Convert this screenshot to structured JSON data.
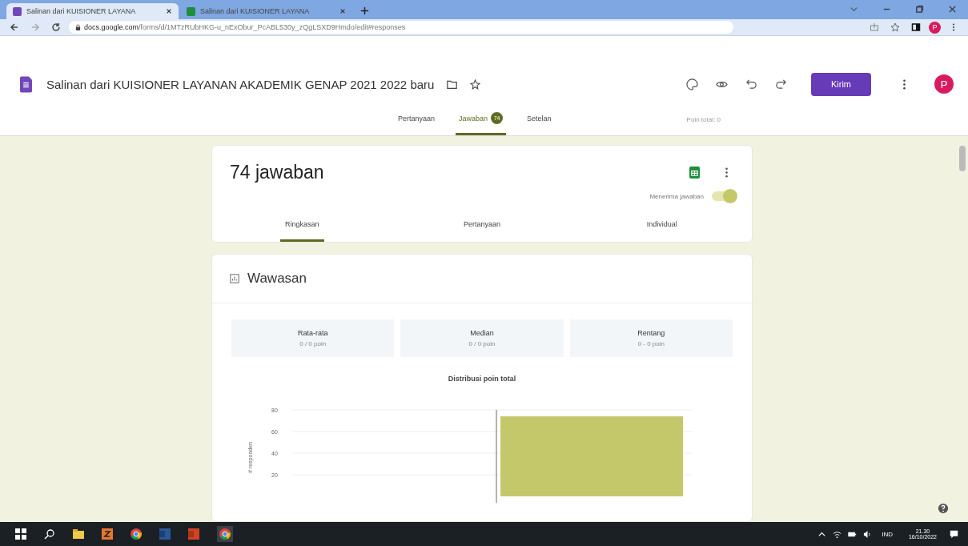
{
  "browser": {
    "tabs": [
      {
        "title": "Salinan dari KUISIONER LAYANA",
        "kind": "forms",
        "selected": true
      },
      {
        "title": "Salinan dari KUISIONER LAYANA",
        "kind": "sheets",
        "selected": false
      }
    ],
    "url_host": "docs.google.com",
    "url_path": "/forms/d/1MTzRUbHKG-u_nExObur_PcABL530y_zQgLSXD9Hmdo/edit#responses",
    "profile_letter": "P"
  },
  "form": {
    "title": "Salinan dari KUISIONER LAYANAN AKADEMIK GENAP 2021 2022 baru",
    "send_button": "Kirim",
    "avatar_letter": "P",
    "tabs": [
      {
        "label": "Pertanyaan",
        "selected": false
      },
      {
        "label": "Jawaban",
        "badge": "74",
        "selected": true
      },
      {
        "label": "Setelan",
        "selected": false
      }
    ],
    "points_total": "Poin total: 0"
  },
  "responses": {
    "heading": "74 jawaban",
    "accepting_label": "Menerima jawaban",
    "accepting": true,
    "tabs": [
      {
        "label": "Ringkasan",
        "selected": true
      },
      {
        "label": "Pertanyaan",
        "selected": false
      },
      {
        "label": "Individual",
        "selected": false
      }
    ]
  },
  "insights": {
    "title": "Wawasan",
    "stats": [
      {
        "label": "Rata-rata",
        "value": "0 / 0 poin"
      },
      {
        "label": "Median",
        "value": "0 / 0 poin"
      },
      {
        "label": "Rentang",
        "value": "0 - 0 poin"
      }
    ],
    "chart_data": {
      "type": "bar",
      "title": "Distribusi poin total",
      "ylabel": "# responden",
      "values": [
        74
      ],
      "ylim": [
        0,
        80
      ],
      "yticks": [
        20,
        40,
        60,
        80
      ],
      "grid": true
    }
  },
  "taskbar": {
    "language": "IND",
    "time": "21.30",
    "date": "16/10/2022"
  }
}
